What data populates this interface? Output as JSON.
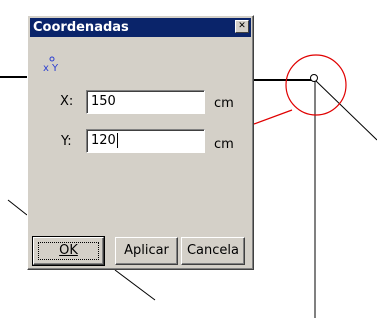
{
  "dialog": {
    "title": "Coordenadas",
    "close_icon": "close-icon",
    "xy_icon": "xy-axis-icon",
    "fields": {
      "x": {
        "label": "X:",
        "value": "150",
        "unit": "cm"
      },
      "y": {
        "label": "Y:",
        "value": "120",
        "unit": "cm"
      }
    },
    "buttons": {
      "ok": "OK",
      "apply": "Aplicar",
      "cancel": "Cancela"
    }
  },
  "colors": {
    "titlebar": "#0a246a",
    "dialog_face": "#d4d0c8",
    "marker_circle": "#e00000"
  }
}
